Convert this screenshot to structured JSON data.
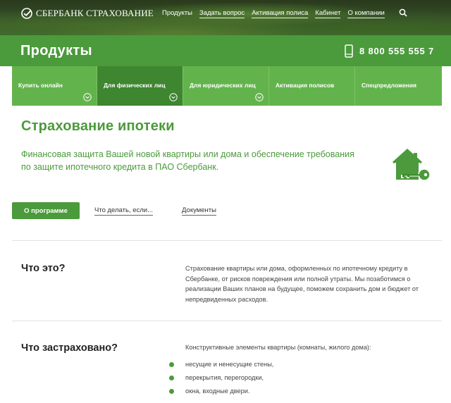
{
  "header": {
    "logo_text": "СБЕРБАНК СТРАХОВАНИЕ",
    "nav": [
      "Продукты",
      "Задать вопрос",
      "Активация полиса",
      "Кабинет",
      "О компании"
    ]
  },
  "titleband": {
    "title": "Продукты",
    "phone": "8 800 555 555 7"
  },
  "tabs": [
    {
      "label": "Купить онлайн",
      "active": false
    },
    {
      "label": "Для физических лиц",
      "active": true
    },
    {
      "label": "Для юридических лиц",
      "active": false
    },
    {
      "label": "Активация полисов",
      "active": false
    },
    {
      "label": "Спецпредложения",
      "active": false
    }
  ],
  "main": {
    "title": "Страхование ипотеки",
    "lead": "Финансовая защита Вашей новой квартиры или дома и обеспечение требования по защите ипотечного кредита в ПАО Сбербанк.",
    "subnav": {
      "about": "О программе",
      "what_to_do": "Что делать, если...",
      "documents": "Документы"
    }
  },
  "sections": {
    "what_is": {
      "heading": "Что это?",
      "text": "Страхование квартиры или дома, оформленных по ипотечному кредиту в Сбербанке, от рисков повреждения или полной утраты. Мы позаботимся о реализации Ваших планов на будущее, поможем сохранить дом и бюджет от непредвиденных расходов."
    },
    "insured": {
      "heading": "Что застраховано?",
      "intro": "Конструктивные элементы квартиры (комнаты, жилого дома):",
      "items": [
        "несущие и ненесущие стены,",
        "перекрытия, перегородки,",
        "окна, входные двери."
      ]
    }
  },
  "colors": {
    "brand_green": "#4b9a3b",
    "tab_green": "#63b34d",
    "tab_active": "#3e8630"
  },
  "icons": [
    "sberbank-logo-icon",
    "search-icon",
    "phone-icon",
    "chevron-down-icon",
    "house-key-icon",
    "bullet-dot"
  ]
}
